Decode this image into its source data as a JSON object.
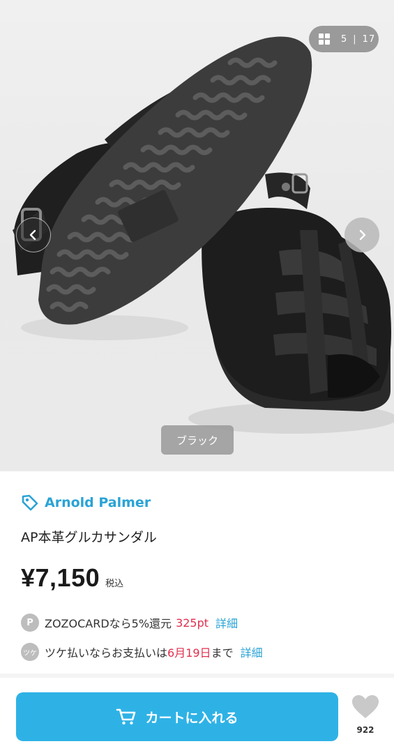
{
  "gallery": {
    "current": "5",
    "separator": "|",
    "total": "17",
    "color_label": "ブラック"
  },
  "product": {
    "brand": "Arnold Palmer",
    "name": "AP本革グルカサンダル",
    "price": "¥7,150",
    "tax_label": "税込"
  },
  "benefits": {
    "zozocard": {
      "badge": "P",
      "text": "ZOZOCARDなら5%還元",
      "points": "325pt",
      "link": "詳細"
    },
    "tsuke": {
      "badge": "ツケ",
      "text_before": "ツケ払いならお支払いは",
      "date": "6月19日",
      "text_after": "まで",
      "link": "詳細"
    }
  },
  "actions": {
    "cart_label": "カートに入れる",
    "favorite_count": "922"
  },
  "colors": {
    "accent": "#2eb2e6",
    "brand_text": "#2aa3d6",
    "highlight_red": "#e0304e"
  }
}
